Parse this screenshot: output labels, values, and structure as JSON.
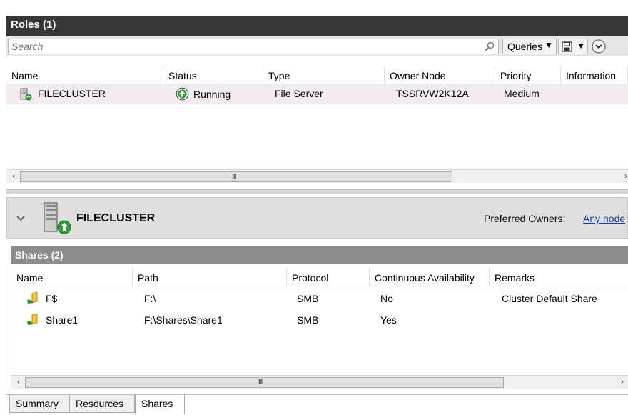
{
  "roles": {
    "header_title": "Roles (1)",
    "search_placeholder": "Search",
    "queries_label": "Queries",
    "columns": [
      "Name",
      "Status",
      "Type",
      "Owner Node",
      "Priority",
      "Information"
    ],
    "rows": [
      {
        "name": "FILECLUSTER",
        "status": "Running",
        "type": "File Server",
        "owner_node": "TSSRVW2K12A",
        "priority": "Medium",
        "information": ""
      }
    ],
    "scroll_grip": "III"
  },
  "detail": {
    "title": "FILECLUSTER",
    "preferred_owners_label": "Preferred Owners:",
    "preferred_owners_link": "Any node"
  },
  "shares": {
    "header_title": "Shares (2)",
    "columns": [
      "Name",
      "Path",
      "Protocol",
      "Continuous Availability",
      "Remarks"
    ],
    "rows": [
      {
        "name": "F$",
        "path": "F:\\",
        "protocol": "SMB",
        "availability": "No",
        "remarks": "Cluster Default Share"
      },
      {
        "name": "Share1",
        "path": "F:\\Shares\\Share1",
        "protocol": "SMB",
        "availability": "Yes",
        "remarks": ""
      }
    ],
    "scroll_grip": "III"
  },
  "tabs": [
    "Summary",
    "Resources",
    "Shares"
  ],
  "icons": {
    "search": "search-icon",
    "save": "save-icon",
    "expand": "expand-chevron-icon",
    "collapse": "collapse-chevron-icon",
    "role": "file-server-role-icon",
    "status": "running-status-icon",
    "share": "folder-share-icon",
    "server": "server-icon"
  },
  "colors": {
    "roles_header_bg": "#373737",
    "shares_header_bg": "#8c8c8c",
    "selected_row_bg": "#f2ebf2",
    "running_green": "#2f9d3a",
    "link_blue": "#1a3c8f"
  }
}
